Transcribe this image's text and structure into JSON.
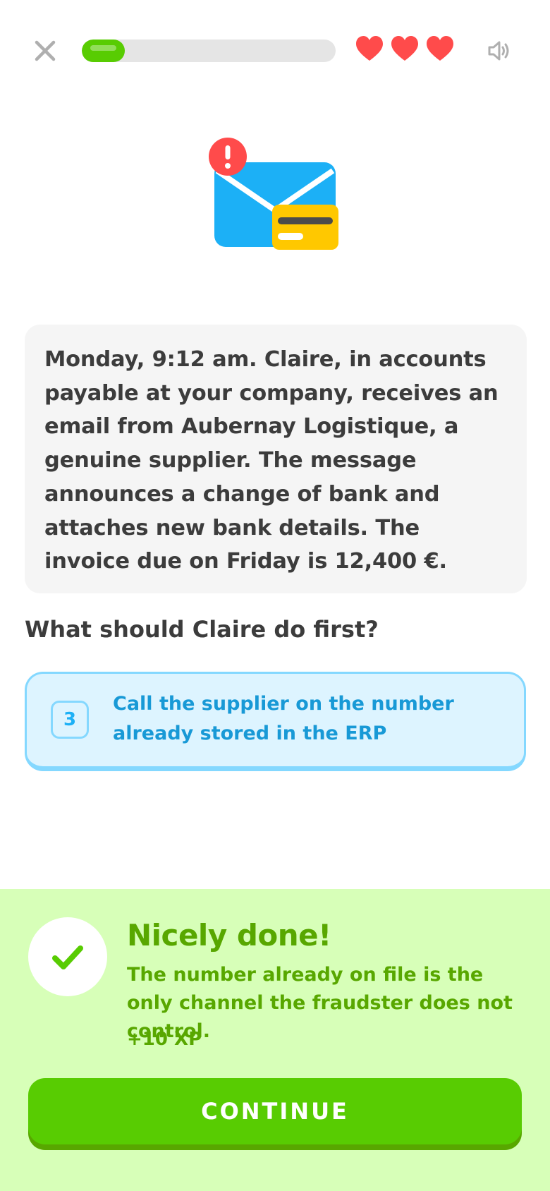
{
  "header": {
    "progress_fraction": 0.17,
    "hearts_count": 3,
    "close_icon": "close-icon",
    "sound_icon": "speaker-icon",
    "colors": {
      "progress": "#58cc02",
      "track": "#e5e5e5",
      "heart": "#ff4b4b"
    }
  },
  "illustration": {
    "icon": "email-alert-icon"
  },
  "scenario": {
    "text": "Monday, 9:12 am. Claire, in accounts payable at your company, receives an email from Aubernay Logistique, a genuine supplier. The message announces a change of bank and attaches new bank details. The invoice due on Friday is 12,400 €."
  },
  "question": "What should Claire do first?",
  "answer": {
    "key": "3",
    "text": "Call the supplier on the number already stored in the ERP",
    "colors": {
      "background": "#ddf4ff",
      "border": "#84d8ff",
      "text": "#1899d6"
    }
  },
  "feedback": {
    "title": "Nicely done!",
    "message": "The number already on file is the only channel the fraudster does not control.",
    "xp": "+10 XP",
    "continue_label": "CONTINUE",
    "colors": {
      "background": "#d7ffb8",
      "text": "#58a700",
      "button": "#58cc02"
    }
  }
}
